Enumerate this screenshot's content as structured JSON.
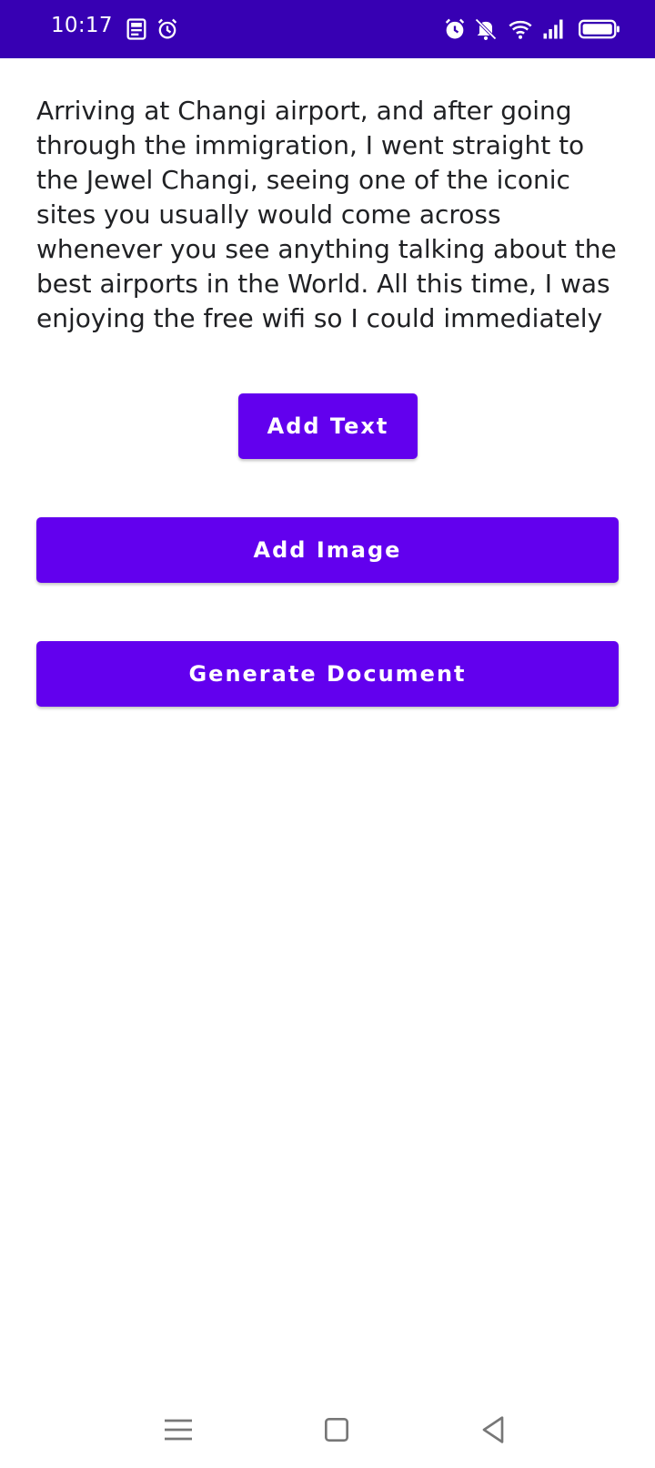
{
  "status_bar": {
    "time": "10:17",
    "bg_color": "#3700b3",
    "left_icons": [
      "news-icon",
      "alarm-icon"
    ],
    "right_icons": [
      "alarm-icon",
      "silent-mode-icon",
      "wifi-icon",
      "cellular-signal-icon",
      "battery-icon"
    ]
  },
  "content": {
    "paragraph": "Arriving at Changi airport, and after going through the immigration, I went straight to the Jewel Changi, seeing one of the iconic sites you usually would come across whenever you see anything talking about the best airports in the World. All this time, I was enjoying the free wifi so I could immediately"
  },
  "buttons": {
    "add_text": "Add Text",
    "add_image": "Add Image",
    "generate_document": "Generate Document",
    "color": "#6200ee"
  },
  "nav_bar": {
    "items": [
      "menu-icon",
      "home-icon",
      "back-icon"
    ]
  }
}
